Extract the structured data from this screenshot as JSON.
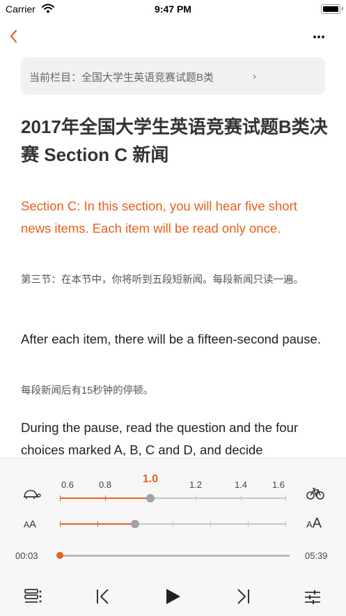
{
  "status_bar": {
    "carrier": "Carrier",
    "time": "9:47 PM",
    "icons": [
      "wifi-icon",
      "battery-icon"
    ]
  },
  "nav": {
    "back_icon": "chevron-left-icon",
    "more_icon": "more-dots-icon"
  },
  "breadcrumb": {
    "text": "当前栏目：全国大学生英语竞赛试题B类",
    "chevron": "›"
  },
  "article": {
    "title": "2017年全国大学生英语竞赛试题B类决赛 Section C 新闻",
    "paragraphs": [
      {
        "type": "en_highlight",
        "text": "Section C: In this section, you will hear five short news items. Each item will be read only once."
      },
      {
        "type": "zh",
        "text": "第三节：在本节中，你将听到五段短新闻。每段新闻只读一遍。"
      },
      {
        "type": "en",
        "text": "After each item, there will be a fifteen-second pause."
      },
      {
        "type": "zh",
        "text": "每段新闻后有15秒钟的停顿。"
      },
      {
        "type": "en",
        "text": "During the pause, read the question and the four choices marked A, B, C and D, and decide"
      }
    ]
  },
  "player": {
    "speed": {
      "labels": [
        "0.6",
        "0.8",
        "1.0",
        "1.2",
        "1.4",
        "1.6"
      ],
      "selected": "1.0",
      "left_icon": "turtle-icon",
      "right_icon": "bicycle-icon"
    },
    "font_size": {
      "small_label": "A",
      "large_label": "A",
      "level_fraction": 0.33
    },
    "progress": {
      "current": "00:03",
      "total": "05:39",
      "fraction": 0.0
    },
    "controls": [
      "playlist-icon",
      "previous-icon",
      "play-icon",
      "next-icon",
      "settings-sliders-icon"
    ]
  },
  "colors": {
    "accent": "#e8601c",
    "panel_bg": "#f7f7f7",
    "breadcrumb_bg": "#f1f1f2"
  }
}
